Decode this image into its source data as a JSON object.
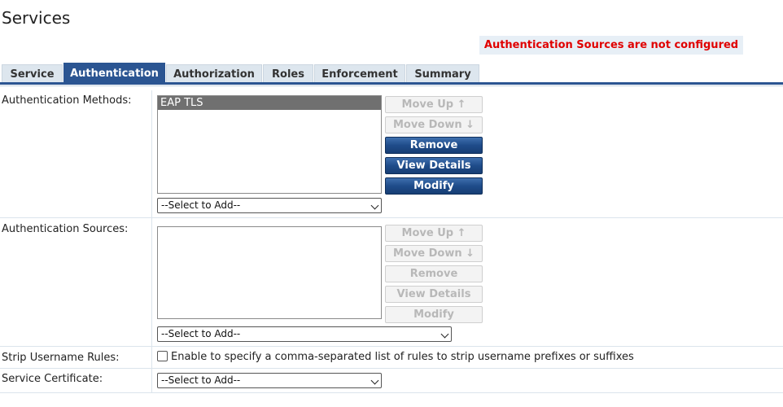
{
  "page": {
    "title": "Services"
  },
  "warning": {
    "text": "Authentication Sources are not configured",
    "color": "#e00000"
  },
  "tabs": [
    {
      "label": "Service",
      "active": false
    },
    {
      "label": "Authentication",
      "active": true
    },
    {
      "label": "Authorization",
      "active": false
    },
    {
      "label": "Roles",
      "active": false
    },
    {
      "label": "Enforcement",
      "active": false
    },
    {
      "label": "Summary",
      "active": false
    }
  ],
  "auth_methods": {
    "label": "Authentication Methods:",
    "items": [
      "EAP TLS"
    ],
    "select": "--Select to Add--",
    "buttons": {
      "move_up": "Move Up ↑",
      "move_down": "Move Down ↓",
      "remove": "Remove",
      "view_details": "View Details",
      "modify": "Modify"
    }
  },
  "auth_sources": {
    "label": "Authentication Sources:",
    "items": [],
    "select": "--Select to Add--",
    "buttons": {
      "move_up": "Move Up ↑",
      "move_down": "Move Down ↓",
      "remove": "Remove",
      "view_details": "View Details",
      "modify": "Modify"
    }
  },
  "strip_username": {
    "label": "Strip Username Rules:",
    "checkbox_label": "Enable to specify a comma-separated list of rules to strip username prefixes or suffixes",
    "checked": false
  },
  "service_certificate": {
    "label": "Service Certificate:",
    "select": "--Select to Add--"
  },
  "colors": {
    "accent": "#2b5592",
    "tab_bg": "#dde6ee"
  }
}
